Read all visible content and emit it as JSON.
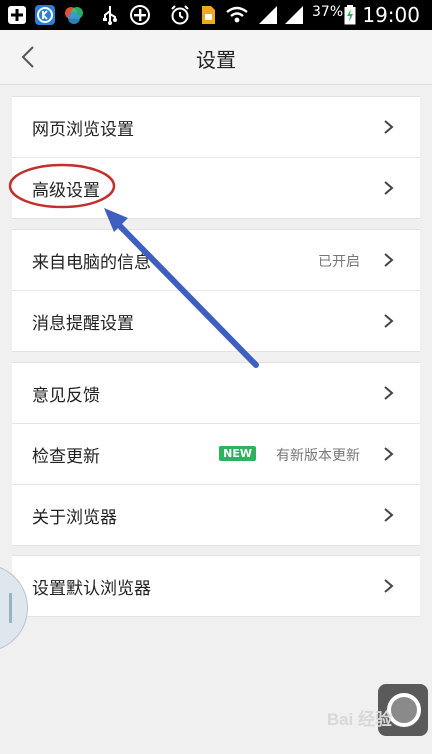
{
  "status_bar": {
    "battery_percent": "37%",
    "time": "19:00"
  },
  "header": {
    "title": "设置"
  },
  "groups": [
    [
      {
        "label": "网页浏览设置",
        "value": ""
      },
      {
        "label": "高级设置",
        "value": ""
      }
    ],
    [
      {
        "label": "来自电脑的信息",
        "value": "已开启"
      },
      {
        "label": "消息提醒设置",
        "value": ""
      }
    ],
    [
      {
        "label": "意见反馈",
        "value": ""
      },
      {
        "label": "检查更新",
        "value": "有新版本更新",
        "badge": "NEW"
      },
      {
        "label": "关于浏览器",
        "value": ""
      }
    ],
    [
      {
        "label": "设置默认浏览器",
        "value": ""
      }
    ]
  ],
  "watermark": "Bai 经验",
  "colors": {
    "badge_green": "#2db35d",
    "annotation_red": "#c0302c",
    "annotation_arrow": "#3f5fc0"
  }
}
